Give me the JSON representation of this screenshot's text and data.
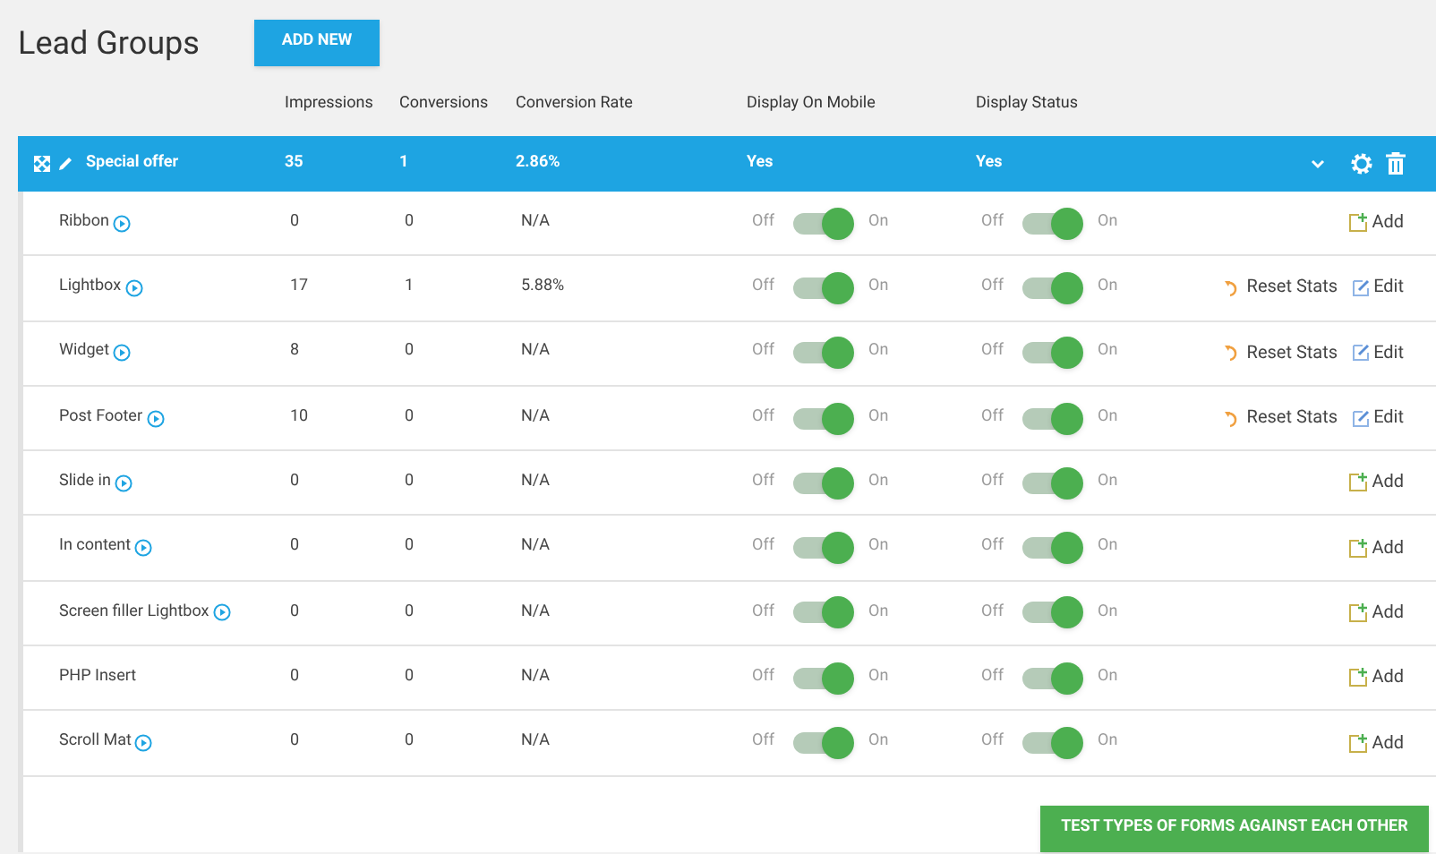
{
  "title": "Lead Groups",
  "add_button": "ADD NEW",
  "columns": [
    "Impressions",
    "Conversions",
    "Conversion Rate",
    "Display On Mobile",
    "Display Status"
  ],
  "group": {
    "name": "Special offer",
    "impressions": "35",
    "conversions": "1",
    "rate": "2.86%",
    "mobile": "Yes",
    "status": "Yes"
  },
  "rows": [
    {
      "name": "Ribbon",
      "has_preview": true,
      "impressions": "0",
      "conversions": "0",
      "rate": "N/A",
      "mobile": {
        "off_label": "Off",
        "on_label": "On",
        "on": true
      },
      "status": {
        "off_label": "Off",
        "on_label": "On",
        "on": true
      },
      "actions": [
        {
          "kind": "add",
          "label": "Add"
        }
      ]
    },
    {
      "name": "Lightbox",
      "has_preview": true,
      "impressions": "17",
      "conversions": "1",
      "rate": "5.88%",
      "mobile": {
        "off_label": "Off",
        "on_label": "On",
        "on": true
      },
      "status": {
        "off_label": "Off",
        "on_label": "On",
        "on": true
      },
      "actions": [
        {
          "kind": "reset",
          "label": "Reset Stats"
        },
        {
          "kind": "edit",
          "label": "Edit"
        }
      ]
    },
    {
      "name": "Widget",
      "has_preview": true,
      "impressions": "8",
      "conversions": "0",
      "rate": "N/A",
      "mobile": {
        "off_label": "Off",
        "on_label": "On",
        "on": true
      },
      "status": {
        "off_label": "Off",
        "on_label": "On",
        "on": true
      },
      "actions": [
        {
          "kind": "reset",
          "label": "Reset Stats"
        },
        {
          "kind": "edit",
          "label": "Edit"
        }
      ]
    },
    {
      "name": "Post Footer",
      "has_preview": true,
      "impressions": "10",
      "conversions": "0",
      "rate": "N/A",
      "mobile": {
        "off_label": "Off",
        "on_label": "On",
        "on": true
      },
      "status": {
        "off_label": "Off",
        "on_label": "On",
        "on": true
      },
      "actions": [
        {
          "kind": "reset",
          "label": "Reset Stats"
        },
        {
          "kind": "edit",
          "label": "Edit"
        }
      ]
    },
    {
      "name": "Slide in",
      "has_preview": true,
      "impressions": "0",
      "conversions": "0",
      "rate": "N/A",
      "mobile": {
        "off_label": "Off",
        "on_label": "On",
        "on": true
      },
      "status": {
        "off_label": "Off",
        "on_label": "On",
        "on": true
      },
      "actions": [
        {
          "kind": "add",
          "label": "Add"
        }
      ]
    },
    {
      "name": "In content",
      "has_preview": true,
      "impressions": "0",
      "conversions": "0",
      "rate": "N/A",
      "mobile": {
        "off_label": "Off",
        "on_label": "On",
        "on": true
      },
      "status": {
        "off_label": "Off",
        "on_label": "On",
        "on": true
      },
      "actions": [
        {
          "kind": "add",
          "label": "Add"
        }
      ]
    },
    {
      "name": "Screen filler Lightbox",
      "has_preview": true,
      "impressions": "0",
      "conversions": "0",
      "rate": "N/A",
      "mobile": {
        "off_label": "Off",
        "on_label": "On",
        "on": true
      },
      "status": {
        "off_label": "Off",
        "on_label": "On",
        "on": true
      },
      "actions": [
        {
          "kind": "add",
          "label": "Add"
        }
      ]
    },
    {
      "name": "PHP Insert",
      "has_preview": false,
      "impressions": "0",
      "conversions": "0",
      "rate": "N/A",
      "mobile": {
        "off_label": "Off",
        "on_label": "On",
        "on": true
      },
      "status": {
        "off_label": "Off",
        "on_label": "On",
        "on": true
      },
      "actions": [
        {
          "kind": "add",
          "label": "Add"
        }
      ]
    },
    {
      "name": "Scroll Mat",
      "has_preview": true,
      "impressions": "0",
      "conversions": "0",
      "rate": "N/A",
      "mobile": {
        "off_label": "Off",
        "on_label": "On",
        "on": true
      },
      "status": {
        "off_label": "Off",
        "on_label": "On",
        "on": true
      },
      "actions": [
        {
          "kind": "add",
          "label": "Add"
        }
      ]
    }
  ],
  "test_button": "TEST TYPES OF FORMS AGAINST EACH OTHER"
}
